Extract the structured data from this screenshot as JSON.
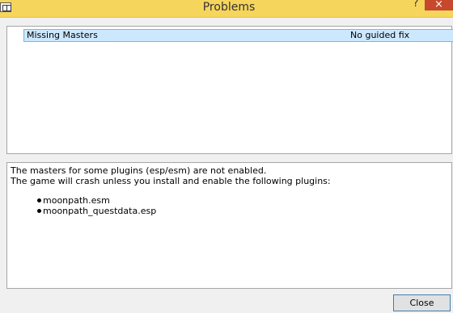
{
  "window": {
    "title": "Problems",
    "help_label": "?",
    "close_label": "×"
  },
  "problems": {
    "items": [
      {
        "title": "Missing Masters",
        "fix": "No guided fix"
      }
    ]
  },
  "details": {
    "line1": "The masters for some plugins (esp/esm) are not enabled.",
    "line2": "The game will crash unless you install and enable the following plugins:",
    "plugins": [
      "moonpath.esm",
      "moonpath_questdata.esp"
    ]
  },
  "footer": {
    "close_button": "Close"
  }
}
